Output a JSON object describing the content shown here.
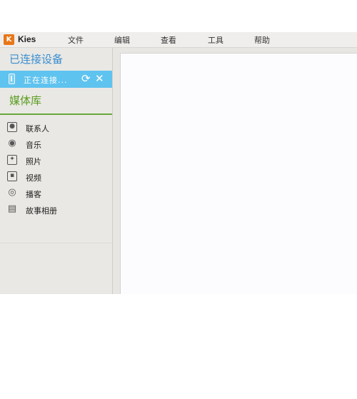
{
  "app": {
    "title": "Kies",
    "logo_text": "K"
  },
  "menu": [
    {
      "label": "文件"
    },
    {
      "label": "编辑"
    },
    {
      "label": "查看"
    },
    {
      "label": "工具"
    },
    {
      "label": "帮助"
    }
  ],
  "sidebar": {
    "connected_title": "已连接设备",
    "device": {
      "status_label": "正在连接...",
      "sync_icon": "refresh-icon",
      "close_icon": "close-icon"
    },
    "media_title": "媒体库",
    "library_items": [
      {
        "label": "联系人",
        "icon": "contacts-icon"
      },
      {
        "label": "音乐",
        "icon": "music-icon"
      },
      {
        "label": "照片",
        "icon": "photo-icon"
      },
      {
        "label": "视频",
        "icon": "video-icon"
      },
      {
        "label": "播客",
        "icon": "podcast-icon"
      },
      {
        "label": "故事相册",
        "icon": "story-album-icon"
      }
    ]
  },
  "colors": {
    "accent_blue": "#3a8ed0",
    "device_highlight": "#5fc3ef",
    "media_green": "#5a9c1f",
    "logo_orange": "#e87718"
  }
}
